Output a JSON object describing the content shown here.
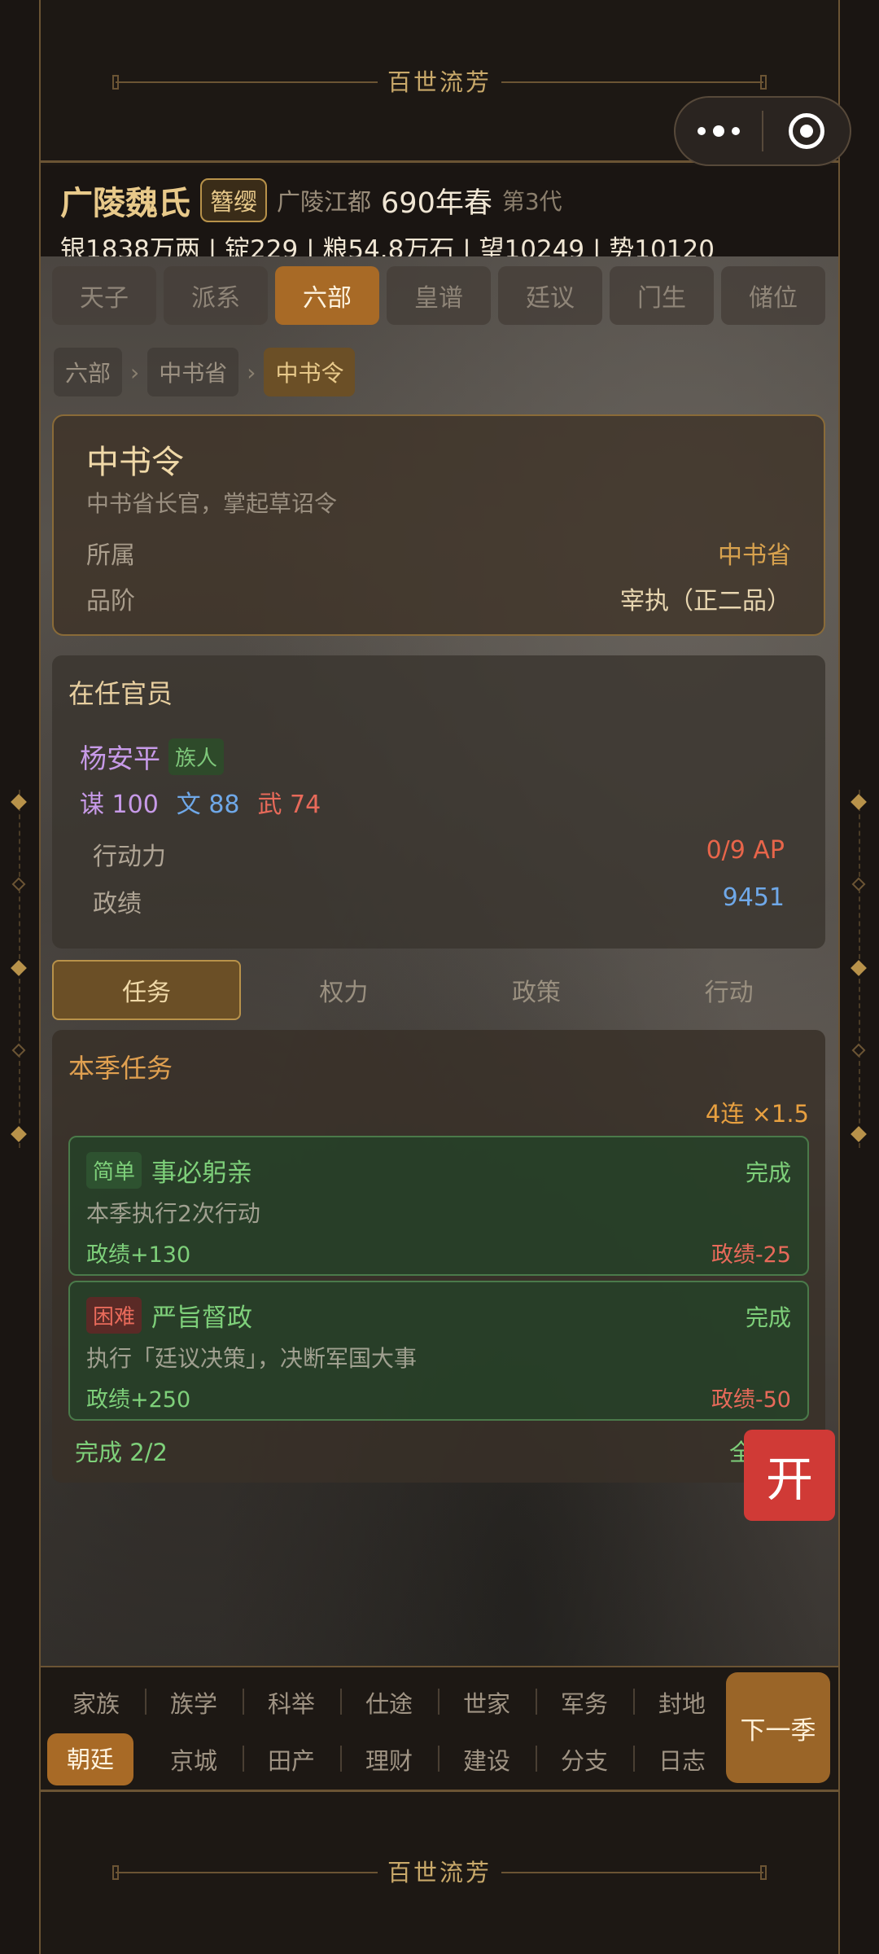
{
  "banner": {
    "title": "百世流芳"
  },
  "header": {
    "clan_name": "广陵魏氏",
    "rank_badge": "簪缨",
    "place": "广陵江都",
    "year": "690年春",
    "generation": "第3代",
    "resources": "银1838万两 | 锭229 | 粮54.8万石 | 望10249 | 势10120"
  },
  "tabs": [
    "天子",
    "派系",
    "六部",
    "皇谱",
    "廷议",
    "门生",
    "储位"
  ],
  "active_tab": "六部",
  "breadcrumb": [
    "六部",
    "中书省",
    "中书令"
  ],
  "office": {
    "title": "中书令",
    "desc": "中书省长官，掌起草诏令",
    "dept_label": "所属",
    "dept_value": "中书省",
    "grade_label": "品阶",
    "grade_value": "宰执（正二品）"
  },
  "official": {
    "section_title": "在任官员",
    "name": "杨安平",
    "tag": "族人",
    "mou": "谋 100",
    "wen": "文 88",
    "wu": "武 74",
    "ap_label": "行动力",
    "ap_value": "0/9 AP",
    "merit_label": "政绩",
    "merit_value": "9451"
  },
  "subtabs": [
    "任务",
    "权力",
    "政策",
    "行动"
  ],
  "tasks": {
    "section_title": "本季任务",
    "combo": "4连 ×1.5",
    "items": [
      {
        "difficulty": "简单",
        "name": "事必躬亲",
        "status": "完成",
        "desc": "本季执行2次行动",
        "reward": "政绩+130",
        "penalty": "政绩-25"
      },
      {
        "difficulty": "困难",
        "name": "严旨督政",
        "status": "完成",
        "desc": "执行「廷议决策」，决断军国大事",
        "reward": "政绩+250",
        "penalty": "政绩-50"
      }
    ],
    "footer_left": "完成 2/2",
    "footer_right": "全部"
  },
  "float_button": "开",
  "bottom_nav": {
    "row1": [
      "家族",
      "族学",
      "科举",
      "仕途",
      "世家",
      "军务",
      "封地"
    ],
    "row2": [
      "朝廷",
      "京城",
      "田产",
      "理财",
      "建设",
      "分支",
      "日志"
    ],
    "next": "下一季"
  }
}
